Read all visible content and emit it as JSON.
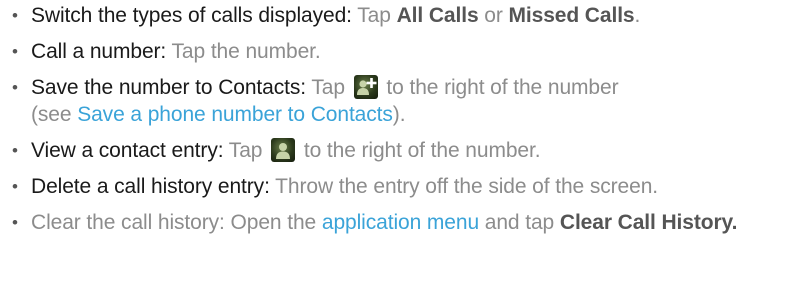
{
  "items": [
    {
      "bullet": "•",
      "label": "Switch the types of calls displayed:",
      "parts": [
        " Tap ",
        "All Calls",
        " or ",
        "Missed Calls",
        "."
      ]
    },
    {
      "bullet": "•",
      "label": "Call a number:",
      "parts": [
        " Tap the number."
      ]
    },
    {
      "bullet": "•",
      "label": "Save the number to Contacts:",
      "parts": [
        " Tap ",
        " to the right of the number",
        "(see ",
        "Save a phone number to Contacts",
        ")."
      ],
      "icon": "add-contact-icon"
    },
    {
      "bullet": "•",
      "label": "View a contact entry:",
      "parts": [
        " Tap ",
        " to the right of the number."
      ],
      "icon": "contact-icon"
    },
    {
      "bullet": "•",
      "label": "Delete a call history entry:",
      "parts": [
        " Throw the entry off the side of the screen."
      ]
    },
    {
      "bullet": "•",
      "parts": [
        "Clear the call history: Open the ",
        "application menu",
        " and tap ",
        "Clear Call History."
      ]
    }
  ],
  "colors": {
    "body_text": "#1a1a1a",
    "secondary_text": "#8c8c8c",
    "bold_text": "#555555",
    "link": "#3aa3d8",
    "icon_bg": "#2c3a1c"
  }
}
